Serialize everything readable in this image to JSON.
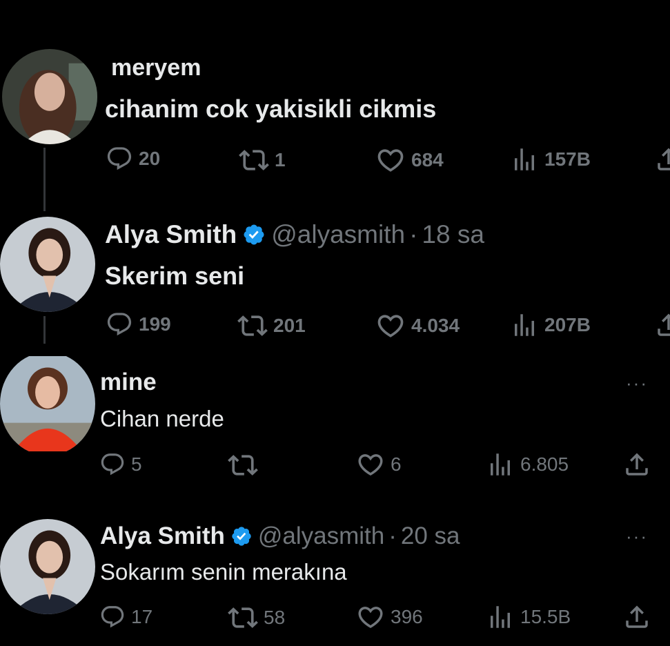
{
  "tweets": [
    {
      "name": "meryem",
      "text": "cihanim cok yakisikli cikmis",
      "replies": "20",
      "retweets": "1",
      "likes": "684",
      "views": "157B"
    },
    {
      "name": "Alya Smith",
      "handle": "@alyasmith",
      "separator": "·",
      "time": "18 sa",
      "text": "Skerim seni",
      "replies": "199",
      "retweets": "201",
      "likes": "4.034",
      "views": "207B"
    },
    {
      "name": "mine",
      "more": "···",
      "text": "Cihan nerde",
      "replies": "5",
      "retweets": "",
      "likes": "6",
      "views": "6.805"
    },
    {
      "name": "Alya Smith",
      "handle": "@alyasmith",
      "separator": "·",
      "time": "20 sa",
      "more": "···",
      "text": "Sokarım senin merakına",
      "replies": "17",
      "retweets": "58",
      "likes": "396",
      "views": "15.5B"
    }
  ],
  "colors": {
    "background": "#000000",
    "text": "#e7e9ea",
    "secondary": "#71767b",
    "verified": "#1d9bf0"
  },
  "icons": [
    "reply-icon",
    "retweet-icon",
    "like-icon",
    "views-icon",
    "share-icon",
    "verified-badge-icon",
    "more-icon"
  ]
}
